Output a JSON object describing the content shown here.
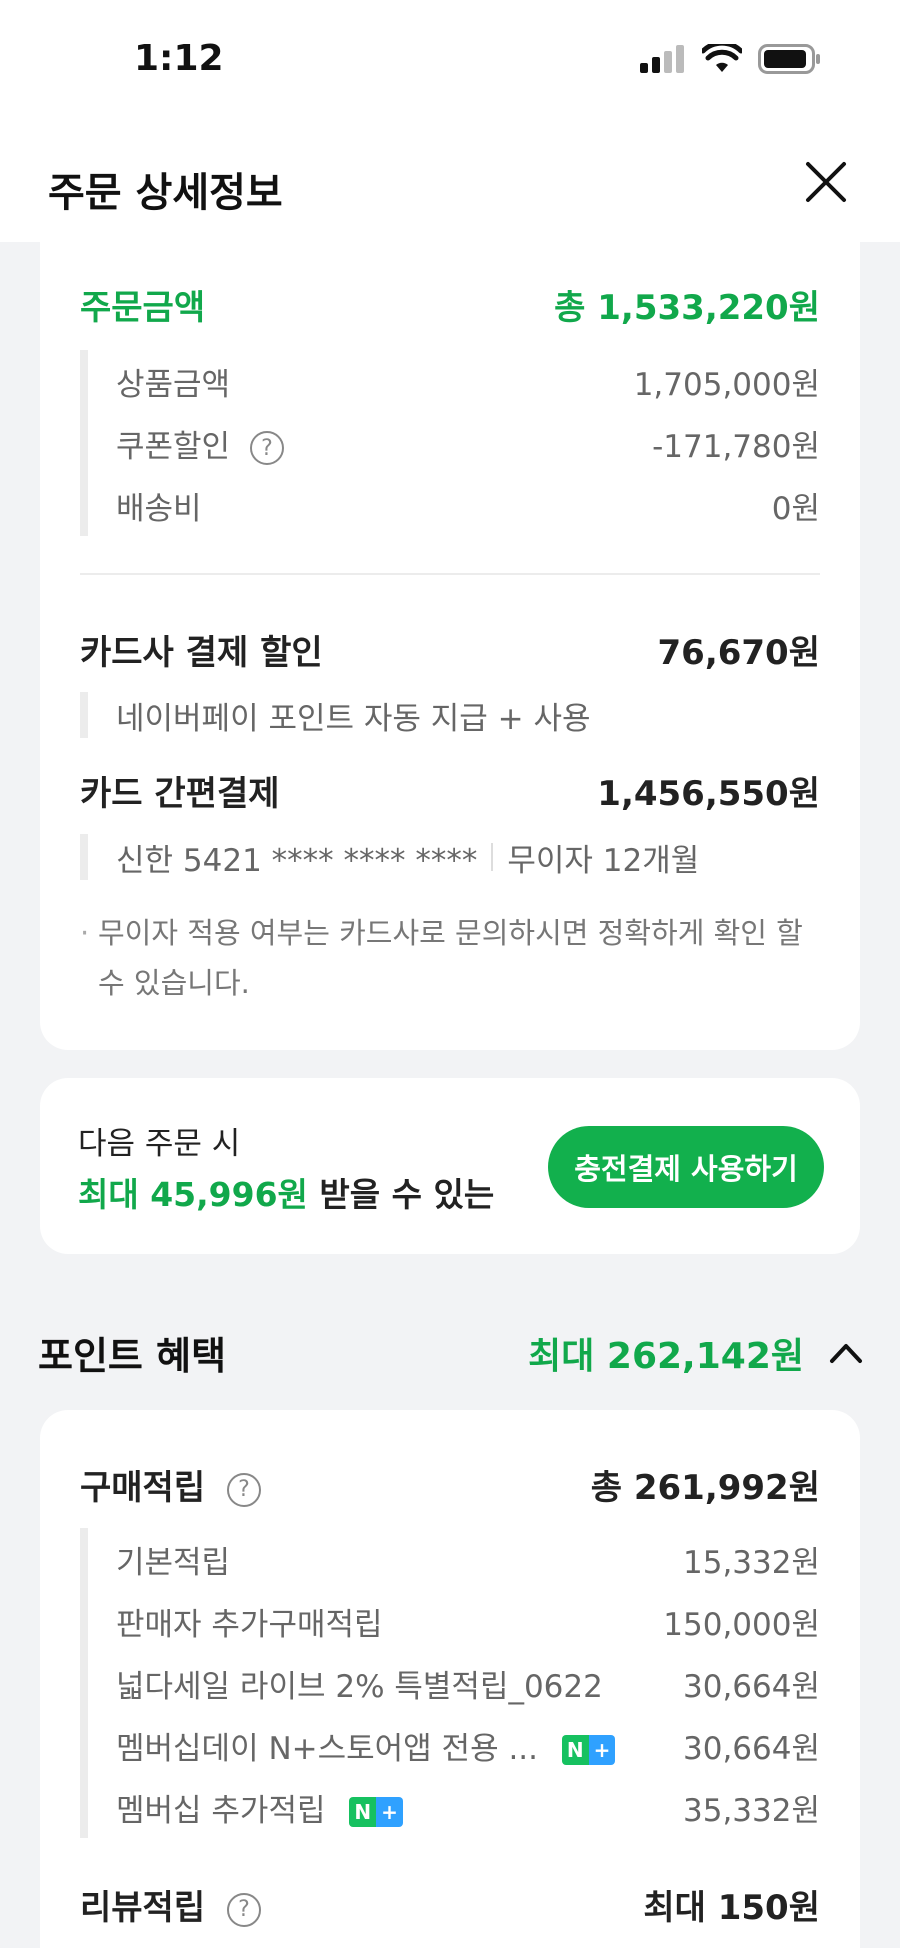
{
  "status_bar": {
    "time": "1:12"
  },
  "header": {
    "title": "주문 상세정보"
  },
  "order": {
    "label": "주문금액",
    "total": "총 1,533,220원",
    "items": [
      {
        "label": "상품금액",
        "value": "1,705,000원"
      },
      {
        "label": "쿠폰할인",
        "value": "-171,780원"
      },
      {
        "label": "배송비",
        "value": "0원"
      }
    ]
  },
  "card_discount": {
    "label": "카드사 결제 할인",
    "value": "76,670원",
    "detail": "네이버페이 포인트 자동 지급 + 사용"
  },
  "card_payment": {
    "label": "카드 간편결제",
    "value": "1,456,550원",
    "card": "신한 5421 **** **** ****",
    "installment": "무이자 12개월",
    "note": "무이자 적용 여부는 카드사로 문의하시면 정확하게 확인 할 수 있습니다."
  },
  "promo": {
    "line1": "다음 주문 시",
    "highlight": "최대 45,996원",
    "line2_rest": " 받을 수 있는",
    "button": "충전결제 사용하기"
  },
  "points": {
    "title": "포인트 혜택",
    "max": "최대 262,142원",
    "purchase": {
      "label": "구매적립",
      "total": "총 261,992원",
      "items": [
        {
          "label": "기본적립",
          "value": "15,332원"
        },
        {
          "label": "판매자 추가구매적립",
          "value": "150,000원"
        },
        {
          "label": "넓다세일 라이브 2% 특별적립_0622",
          "value": "30,664원"
        },
        {
          "label": "멤버십데이 N+스토어앱 전용 ...",
          "value": "30,664원"
        },
        {
          "label": "멤버십 추가적립",
          "value": "35,332원"
        }
      ]
    },
    "review": {
      "label": "리뷰적립",
      "value": "최대 150원"
    }
  },
  "badge": {
    "n": "N",
    "plus": "+"
  },
  "colors": {
    "accent_green": "#11a84b",
    "button_green": "#12b04d"
  }
}
